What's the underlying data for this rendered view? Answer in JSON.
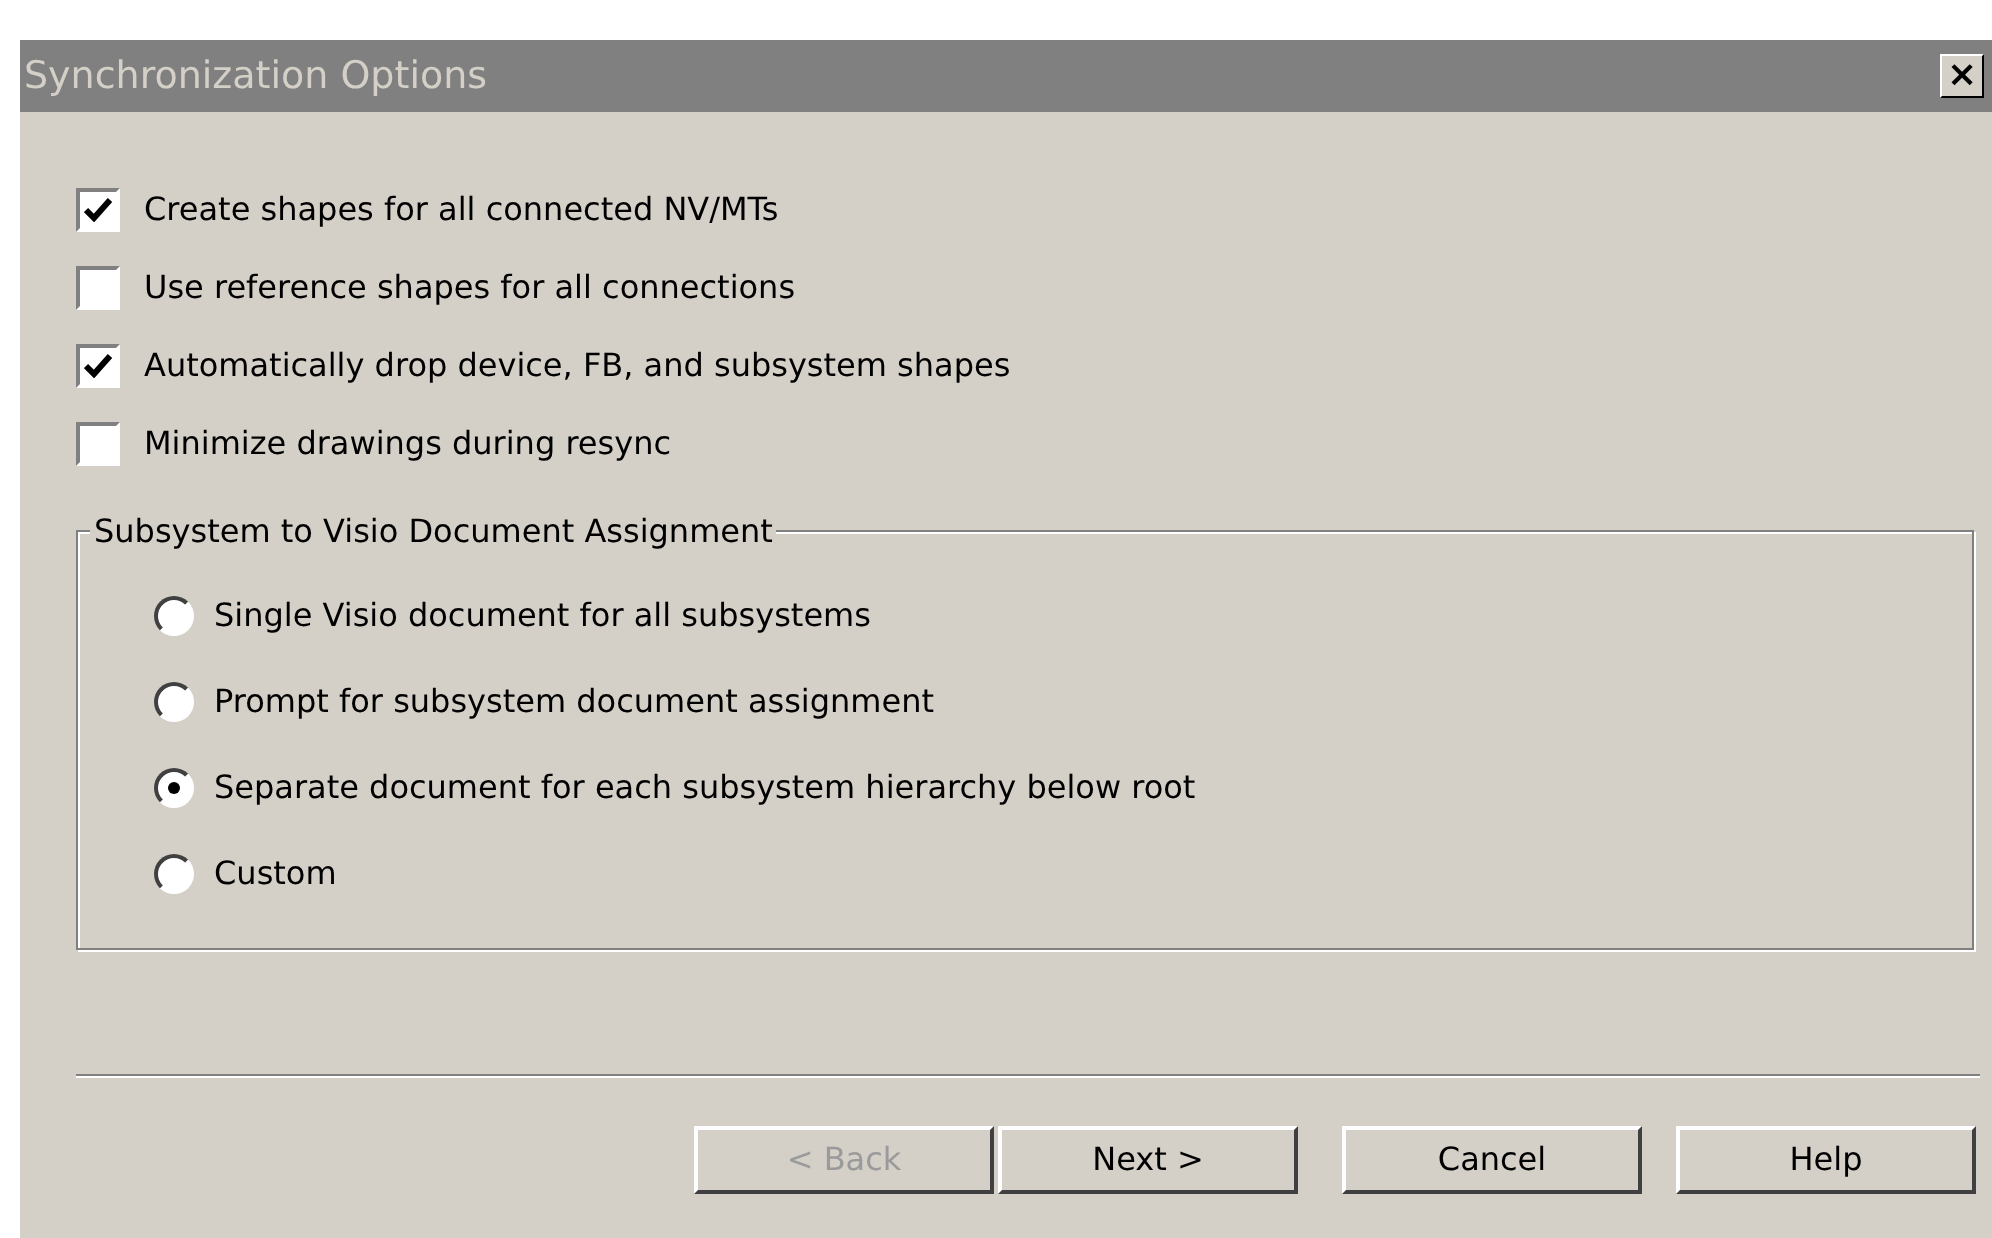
{
  "window": {
    "title": "Synchronization Options",
    "close": "×"
  },
  "options": [
    {
      "label": "Create shapes for all connected NV/MTs",
      "checked": true
    },
    {
      "label": "Use reference shapes for all connections",
      "checked": false
    },
    {
      "label": "Automatically drop device, FB, and subsystem shapes",
      "checked": true
    },
    {
      "label": "Minimize drawings during resync",
      "checked": false
    }
  ],
  "group": {
    "title": "Subsystem to Visio Document Assignment",
    "choices": [
      {
        "label": "Single Visio document for all subsystems",
        "selected": false
      },
      {
        "label": "Prompt for subsystem document assignment",
        "selected": false
      },
      {
        "label": "Separate document for each subsystem hierarchy below root",
        "selected": true
      },
      {
        "label": "Custom",
        "selected": false
      }
    ]
  },
  "buttons": [
    {
      "label": "< Back",
      "disabled": true
    },
    {
      "label": "Next >",
      "disabled": false
    },
    {
      "label": "Cancel",
      "disabled": false
    },
    {
      "label": "Help",
      "disabled": false
    }
  ]
}
